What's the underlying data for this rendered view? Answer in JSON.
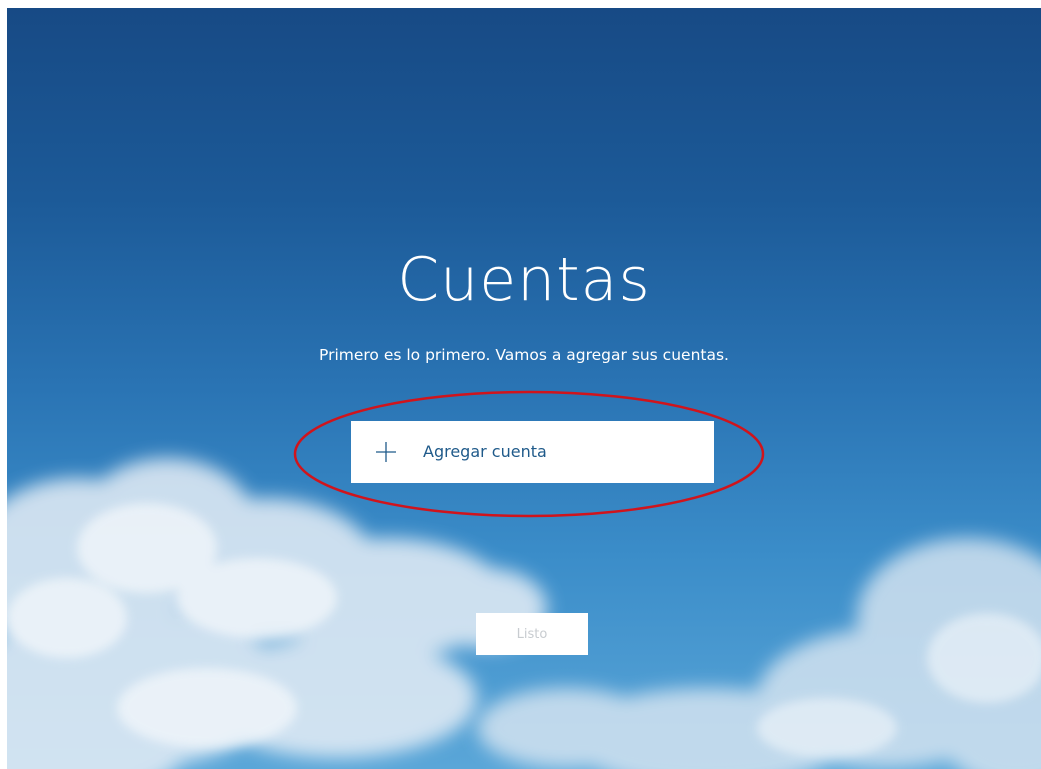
{
  "page": {
    "title": "Cuentas",
    "subtitle": "Primero es lo primero. Vamos a agregar sus cuentas."
  },
  "add_account": {
    "icon": "plus-icon",
    "label": "Agregar cuenta"
  },
  "done_button": {
    "label": "Listo",
    "state": "disabled"
  },
  "annotation": {
    "shape": "ellipse",
    "color": "#d0141c"
  },
  "colors": {
    "sky_top": "#174a85",
    "sky_bottom": "#5aa6d8",
    "accent_text": "#1f5a8a",
    "button_bg": "#ffffff",
    "disabled_text": "#c8ccd0"
  }
}
